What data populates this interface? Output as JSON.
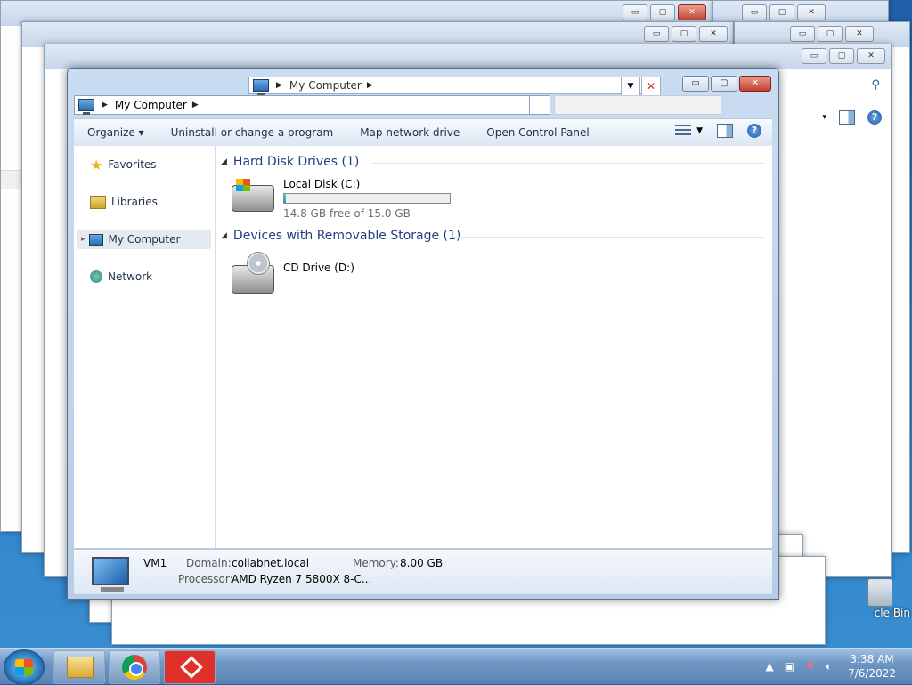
{
  "window": {
    "title_path": "My Computer",
    "address": "My Computer",
    "controls": {
      "minimize": "▭",
      "maximize": "▢",
      "close": "✕"
    }
  },
  "toolbar": {
    "items": [
      "Organize",
      "Uninstall or change a program",
      "Map network drive",
      "Open Control Panel"
    ],
    "organize_caret": "▾"
  },
  "nav": {
    "items": [
      {
        "label": "Favorites",
        "icon": "star-icon"
      },
      {
        "label": "Libraries",
        "icon": "libraries-icon"
      },
      {
        "label": "My Computer",
        "icon": "computer-icon"
      },
      {
        "label": "Network",
        "icon": "network-icon"
      }
    ]
  },
  "groups": {
    "hdd": {
      "title": "Hard Disk Drives (1)",
      "drive": {
        "name": "Local Disk (C:)",
        "free_text": "14.8 GB free of 15.0 GB",
        "used_fraction": 0.013
      }
    },
    "removable": {
      "title": "Devices with Removable Storage (1)",
      "drive": {
        "name": "CD Drive (D:)"
      }
    }
  },
  "details": {
    "name": "VM1",
    "domain_label": "Domain:",
    "domain_value": "collabnet.local",
    "memory_label": "Memory:",
    "memory_value": "8.00 GB",
    "processor_label": "Processor:",
    "processor_value": "AMD Ryzen 7 5800X 8-C..."
  },
  "desktop": {
    "recycle_label": "cle Bin"
  },
  "taskbar": {
    "time": "3:38 AM",
    "date": "7/6/2022"
  },
  "colors": {
    "group_heading": "#1f3e83",
    "accent": "#2a6bb3"
  }
}
